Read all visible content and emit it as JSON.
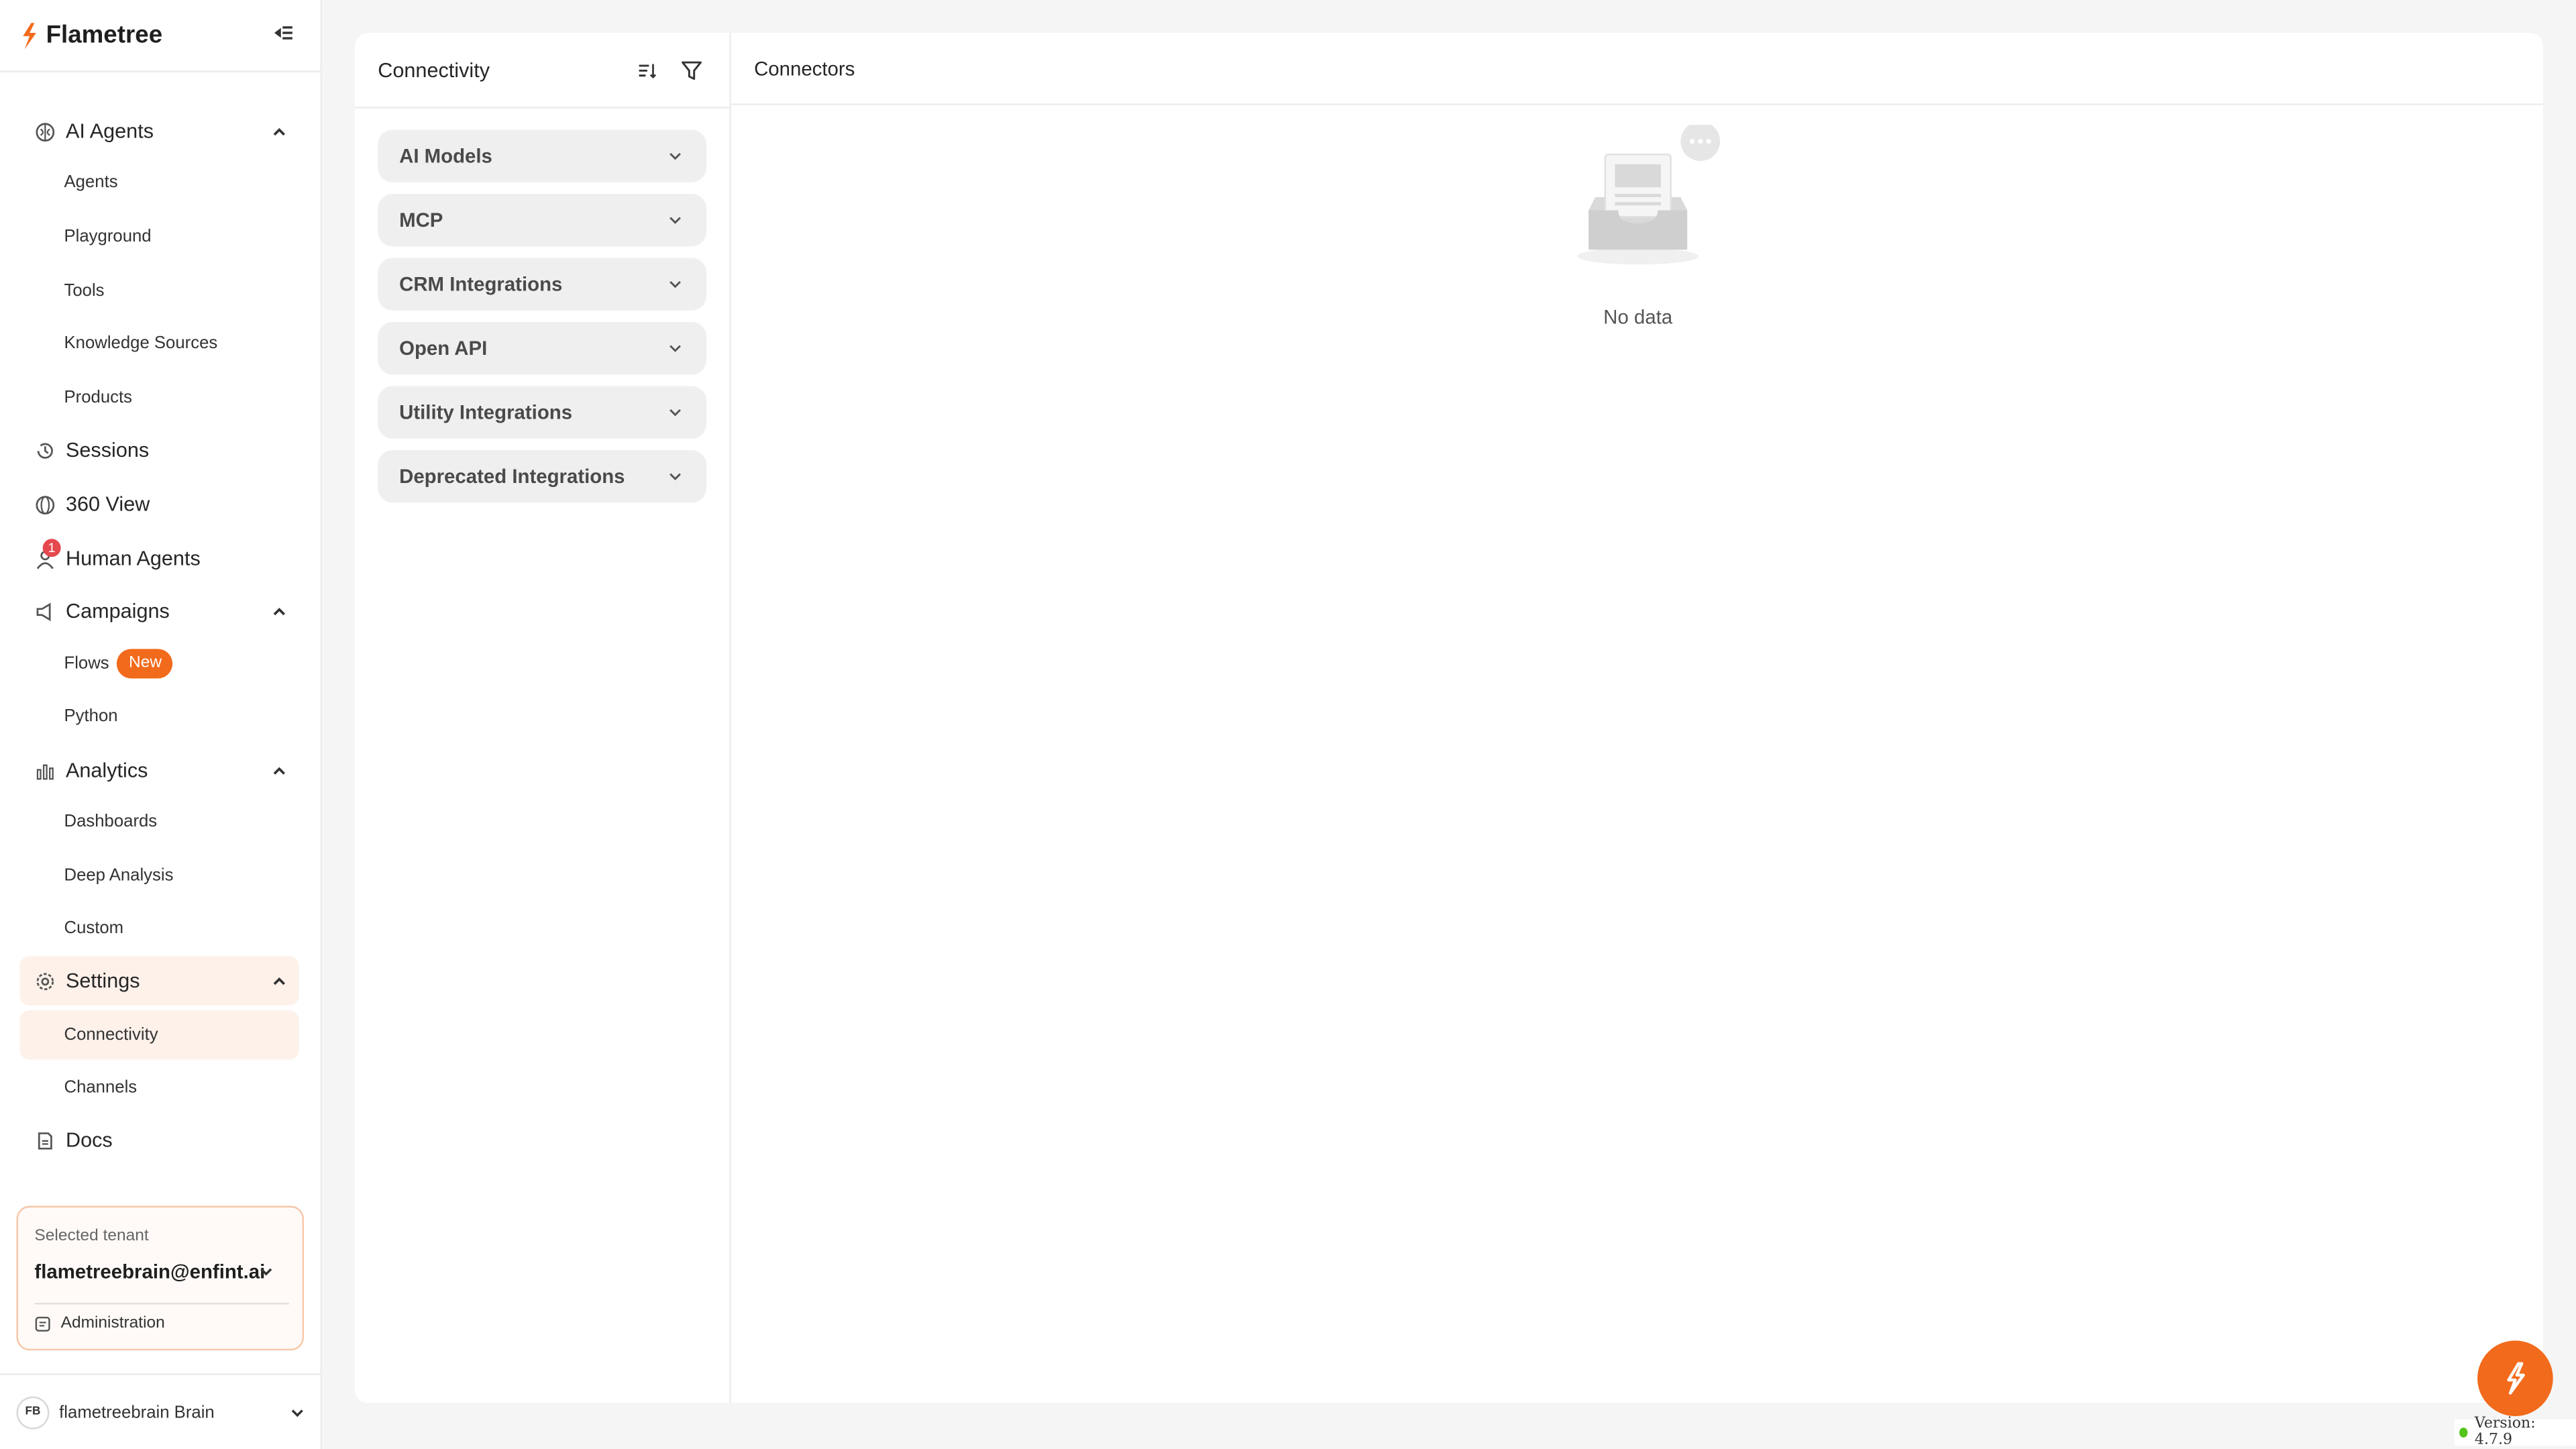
{
  "app": {
    "name": "Flametree",
    "brand_color": "#f26a1b"
  },
  "sidebar": {
    "nav": [
      {
        "label": "AI Agents",
        "icon": "brain-icon",
        "expanded": true
      },
      {
        "label": "Agents"
      },
      {
        "label": "Playground"
      },
      {
        "label": "Tools"
      },
      {
        "label": "Knowledge Sources"
      },
      {
        "label": "Products"
      },
      {
        "label": "Sessions",
        "icon": "history-icon"
      },
      {
        "label": "360 View",
        "icon": "globe-icon"
      },
      {
        "label": "Human Agents",
        "icon": "user-icon",
        "badge": "1"
      },
      {
        "label": "Campaigns",
        "icon": "megaphone-icon",
        "expanded": true
      },
      {
        "label": "Flows",
        "badge": "New"
      },
      {
        "label": "Python"
      },
      {
        "label": "Analytics",
        "icon": "bar-chart-icon",
        "expanded": true
      },
      {
        "label": "Dashboards"
      },
      {
        "label": "Deep Analysis"
      },
      {
        "label": "Custom"
      },
      {
        "label": "Settings",
        "icon": "gear-icon",
        "expanded": true,
        "active": true
      },
      {
        "label": "Connectivity",
        "active": true
      },
      {
        "label": "Channels"
      },
      {
        "label": "Docs",
        "icon": "docs-icon"
      }
    ],
    "tenant": {
      "label": "Selected tenant",
      "value": "flametreebrain@enfint.ai",
      "admin": "Administration"
    },
    "user": {
      "initials": "FB",
      "name": "flametreebrain Brain"
    }
  },
  "connectivity": {
    "title": "Connectivity",
    "categories": [
      "AI Models",
      "MCP",
      "CRM Integrations",
      "Open API",
      "Utility Integrations",
      "Deprecated Integrations"
    ]
  },
  "connectors": {
    "title": "Connectors",
    "empty_text": "No data"
  },
  "footer": {
    "version": "Version: 4.7.9",
    "status_color": "#52c41a"
  }
}
